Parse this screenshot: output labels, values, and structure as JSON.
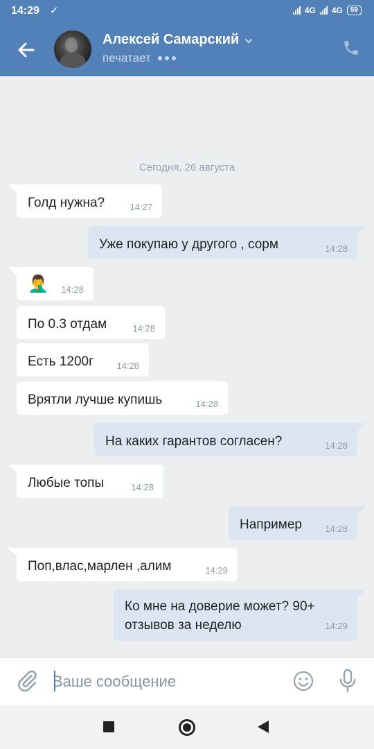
{
  "status_bar": {
    "time": "14:29",
    "network1": "4G",
    "network2": "4G",
    "battery": "59"
  },
  "header": {
    "contact_name": "Алексей Самарский",
    "status_text": "печатает"
  },
  "chat": {
    "date_separator": "Сегодня, 26 августа",
    "messages": [
      {
        "dir": "in",
        "text": "Голд нужна?",
        "time": "14:27"
      },
      {
        "dir": "out",
        "text": "Уже покупаю у другого , сорм",
        "time": "14:28"
      },
      {
        "dir": "in",
        "text": "🤦‍♂️",
        "time": "14:28"
      },
      {
        "dir": "in",
        "text": "По 0.3 отдам",
        "time": "14:28"
      },
      {
        "dir": "in",
        "text": "Есть 1200г",
        "time": "14:28"
      },
      {
        "dir": "in",
        "text": "Врятли лучше купишь",
        "time": "14:28"
      },
      {
        "dir": "out",
        "text": "На каких гарантов согласен?",
        "time": "14:28"
      },
      {
        "dir": "in",
        "text": "Любые топы",
        "time": "14:28"
      },
      {
        "dir": "out",
        "text": "Например",
        "time": "14:28"
      },
      {
        "dir": "in",
        "text": "Поп,влас,марлен ,алим",
        "time": "14:29"
      },
      {
        "dir": "out",
        "text": "Ко мне на доверие может? 90+ отзывов за неделю",
        "time": "14:29"
      }
    ]
  },
  "composer": {
    "placeholder": "Ваше сообщение"
  },
  "colors": {
    "header_blue": "#5181b8",
    "bubble_out": "#dce6f2",
    "bubble_in": "#ffffff",
    "chat_bg": "#edeef0"
  },
  "icons": [
    "back-arrow-icon",
    "chevron-down-icon",
    "phone-icon",
    "paperclip-icon",
    "emoji-icon",
    "microphone-icon"
  ]
}
